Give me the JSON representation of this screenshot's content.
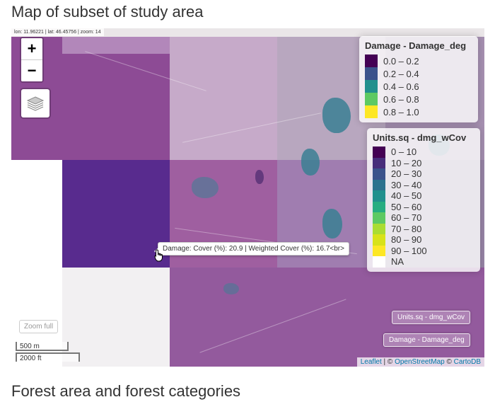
{
  "headings": {
    "title": "Map of subset of study area",
    "next_section": "Forest area and forest categories"
  },
  "map": {
    "coords_readout": "lon: 11.96221 | lat: 46.45756 | zoom: 14",
    "zoom_in_label": "+",
    "zoom_out_label": "−",
    "layers_icon": "layers-icon",
    "tooltip": "Damage: Cover (%): 20.9 | Weighted Cover (%): 16.7<br>",
    "buttons": {
      "units_layer": "Units.sq - dmg_wCov",
      "damage_layer": "Damage - Damage_deg",
      "zoom_full": "Zoom full"
    },
    "scale": {
      "metric": "500 m",
      "imperial": "2000 ft"
    },
    "attribution": {
      "leaflet": "Leaflet",
      "sep1": " | © ",
      "osm": "OpenStreetMap",
      "sep2": " © ",
      "carto": "CartoDB"
    }
  },
  "legend_damage": {
    "title": "Damage - Damage_deg",
    "items": [
      {
        "label": "0.0 – 0.2",
        "color": "#440154"
      },
      {
        "label": "0.2 – 0.4",
        "color": "#3b528b"
      },
      {
        "label": "0.4 – 0.6",
        "color": "#21908d"
      },
      {
        "label": "0.6 – 0.8",
        "color": "#5dc963"
      },
      {
        "label": "0.8 – 1.0",
        "color": "#fde725"
      }
    ]
  },
  "legend_units": {
    "title": "Units.sq - dmg_wCov",
    "items": [
      {
        "label": "0 – 10",
        "color": "#440154"
      },
      {
        "label": "10 – 20",
        "color": "#472d7b"
      },
      {
        "label": "20 – 30",
        "color": "#3b528b"
      },
      {
        "label": "30 – 40",
        "color": "#2c728e"
      },
      {
        "label": "40 – 50",
        "color": "#21908d"
      },
      {
        "label": "50 – 60",
        "color": "#27ad81"
      },
      {
        "label": "60 – 70",
        "color": "#5dc963"
      },
      {
        "label": "70 – 80",
        "color": "#aadc32"
      },
      {
        "label": "80 – 90",
        "color": "#d8e219"
      },
      {
        "label": "90 – 100",
        "color": "#fde725"
      },
      {
        "label": "NA",
        "color": "#ffffff"
      }
    ]
  }
}
